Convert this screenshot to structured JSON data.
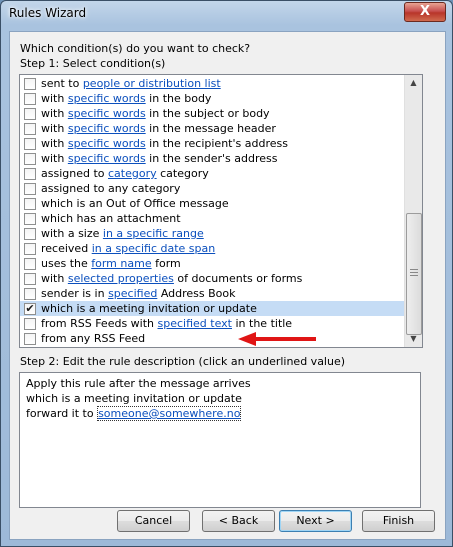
{
  "window": {
    "title": "Rules Wizard",
    "close_label": "X"
  },
  "prompt": "Which condition(s) do you want to check?",
  "step1_label": "Step 1: Select condition(s)",
  "conditions": [
    {
      "before": "sent to ",
      "link": "people or distribution list",
      "after": "",
      "checked": false,
      "selected": false
    },
    {
      "before": "with ",
      "link": "specific words",
      "after": " in the body",
      "checked": false,
      "selected": false
    },
    {
      "before": "with ",
      "link": "specific words",
      "after": " in the subject or body",
      "checked": false,
      "selected": false
    },
    {
      "before": "with ",
      "link": "specific words",
      "after": " in the message header",
      "checked": false,
      "selected": false
    },
    {
      "before": "with ",
      "link": "specific words",
      "after": " in the recipient's address",
      "checked": false,
      "selected": false
    },
    {
      "before": "with ",
      "link": "specific words",
      "after": " in the sender's address",
      "checked": false,
      "selected": false
    },
    {
      "before": "assigned to ",
      "link": "category",
      "after": " category",
      "checked": false,
      "selected": false
    },
    {
      "before": "assigned to any category",
      "link": "",
      "after": "",
      "checked": false,
      "selected": false
    },
    {
      "before": "which is an Out of Office message",
      "link": "",
      "after": "",
      "checked": false,
      "selected": false
    },
    {
      "before": "which has an attachment",
      "link": "",
      "after": "",
      "checked": false,
      "selected": false
    },
    {
      "before": "with a size ",
      "link": "in a specific range",
      "after": "",
      "checked": false,
      "selected": false
    },
    {
      "before": "received ",
      "link": "in a specific date span",
      "after": "",
      "checked": false,
      "selected": false
    },
    {
      "before": "uses the ",
      "link": "form name",
      "after": " form",
      "checked": false,
      "selected": false
    },
    {
      "before": "with ",
      "link": "selected properties",
      "after": " of documents or forms",
      "checked": false,
      "selected": false
    },
    {
      "before": "sender is in ",
      "link": "specified",
      "after": " Address Book",
      "checked": false,
      "selected": false
    },
    {
      "before": "which is a meeting invitation or update",
      "link": "",
      "after": "",
      "checked": true,
      "selected": true
    },
    {
      "before": "from RSS Feeds with ",
      "link": "specified text",
      "after": " in the title",
      "checked": false,
      "selected": false
    },
    {
      "before": "from any RSS Feed",
      "link": "",
      "after": "",
      "checked": false,
      "selected": false
    }
  ],
  "check_glyph": "✔",
  "step2_label": "Step 2: Edit the rule description (click an underlined value)",
  "description": {
    "line1": "Apply this rule after the message arrives",
    "line2": "which is a meeting invitation or update",
    "line3_prefix": "forward it to ",
    "line3_link": "someone@somewhere.no"
  },
  "buttons": {
    "cancel": "Cancel",
    "back": "< Back",
    "next": "Next >",
    "finish": "Finish"
  },
  "annotation": {
    "arrow_color": "#e01515"
  }
}
